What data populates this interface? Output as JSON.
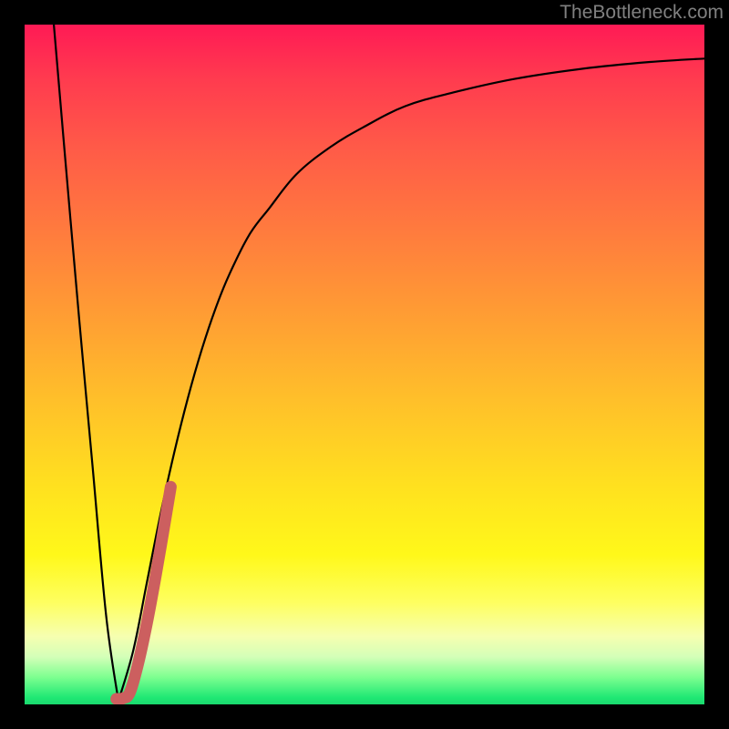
{
  "watermark": {
    "text": "TheBottleneck.com"
  },
  "colors": {
    "frame": "#000000",
    "curve_thin": "#000000",
    "curve_accent": "#cc5f5f",
    "watermark": "#808080"
  },
  "chart_data": {
    "type": "line",
    "title": "",
    "xlabel": "",
    "ylabel": "",
    "xlim": [
      0,
      100
    ],
    "ylim": [
      0,
      100
    ],
    "grid": false,
    "legend": false,
    "note": "Axes have no visible tick labels; values are relative percentages inferred from plot extents.",
    "series": [
      {
        "name": "left-descent",
        "stroke": "curve_thin",
        "x": [
          4.3,
          6.0,
          8.0,
          10.0,
          12.0,
          13.8
        ],
        "y": [
          100,
          80,
          57,
          35,
          13,
          0.5
        ]
      },
      {
        "name": "right-rise",
        "stroke": "curve_thin",
        "x": [
          13.8,
          16,
          18,
          20,
          22,
          24,
          26,
          28,
          30,
          33,
          36,
          40,
          45,
          50,
          56,
          63,
          72,
          82,
          92,
          100
        ],
        "y": [
          0.5,
          8,
          18,
          28,
          37,
          45,
          52,
          58,
          63,
          69,
          73,
          78,
          82,
          85,
          88,
          90,
          92,
          93.5,
          94.5,
          95
        ]
      },
      {
        "name": "accent-segment",
        "stroke": "curve_accent",
        "x": [
          13.5,
          14.5,
          15.5,
          16.7,
          18.0,
          19.3,
          20.5,
          21.5
        ],
        "y": [
          0.8,
          0.9,
          1.8,
          6.0,
          12.0,
          19.0,
          26.0,
          32.0
        ]
      }
    ]
  }
}
